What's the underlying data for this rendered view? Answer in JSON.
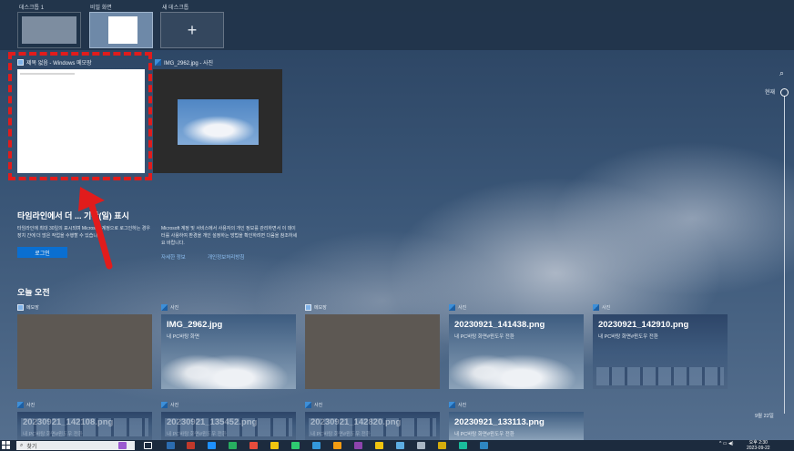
{
  "desktops": [
    {
      "label": "데스크톱 1"
    },
    {
      "label": "비밀 화면"
    },
    {
      "label": "새 데스크톱"
    }
  ],
  "windows": [
    {
      "title": "제목 없음 - Windows 메모장",
      "icon": "notepad-icon"
    },
    {
      "title": "IMG_2962.jpg - 사진",
      "icon": "photos-icon"
    }
  ],
  "timeline_promo": {
    "title": "타임라인에서 더 ... 기간(일) 표시",
    "text": "타임라인에 최대 30일의 표시되며 Microsoft 계정으로 로그인하는 경우 장치 간에 더 많은 작업을 수행할 수 있습니다.",
    "login_label": "로그인",
    "privacy_text": "Microsoft 계정 및 서비스에서 사용자의 개인 정보를 관리하면서 이 데이터를 사용하여 환경을 개인 설정하는 방법을 확인하려면 다음을 참조하세요 바랍니다.",
    "link_more": "자세한 정보",
    "link_privacy": "개인정보처리방침"
  },
  "section": {
    "title": "오늘 오전"
  },
  "cards": [
    {
      "app": "메모장",
      "icon": "notepad-icon",
      "title": "",
      "subtitle": ""
    },
    {
      "app": "사진",
      "icon": "photos-icon",
      "title": "IMG_2962.jpg",
      "subtitle": "내 PC바탕 화면"
    },
    {
      "app": "메모장",
      "icon": "notepad-icon",
      "title": "",
      "subtitle": ""
    },
    {
      "app": "사진",
      "icon": "photos-icon",
      "title": "20230921_141438.png",
      "subtitle": "내 PC바탕 화면#윈도우 전환"
    },
    {
      "app": "사진",
      "icon": "photos-icon",
      "title": "20230921_142910.png",
      "subtitle": "내 PC바탕 화면#윈도우 전환"
    },
    {
      "app": "사진",
      "icon": "photos-icon",
      "title": "20230921_142108.png",
      "subtitle": "내 PC바탕 화면#윈도우 전환"
    },
    {
      "app": "사진",
      "icon": "photos-icon",
      "title": "20230921_135452.png",
      "subtitle": "내 PC바탕 화면#윈도우 전환"
    },
    {
      "app": "사진",
      "icon": "photos-icon",
      "title": "20230921_142820.png",
      "subtitle": "내 PC바탕 화면#윈도우 전환"
    },
    {
      "app": "사진",
      "icon": "photos-icon",
      "title": "20230921_133113.png",
      "subtitle": "내 PC바탕 화면#윈도우 전환"
    }
  ],
  "timeline": {
    "now_label": "현재",
    "date_label": "9월 22일"
  },
  "taskbar": {
    "search_placeholder": "찾기",
    "clock_time": "오후 2:30",
    "clock_date": "2023-09-22"
  },
  "colors": {
    "accent": "#0a6fd1",
    "highlight": "#e11c1c"
  }
}
